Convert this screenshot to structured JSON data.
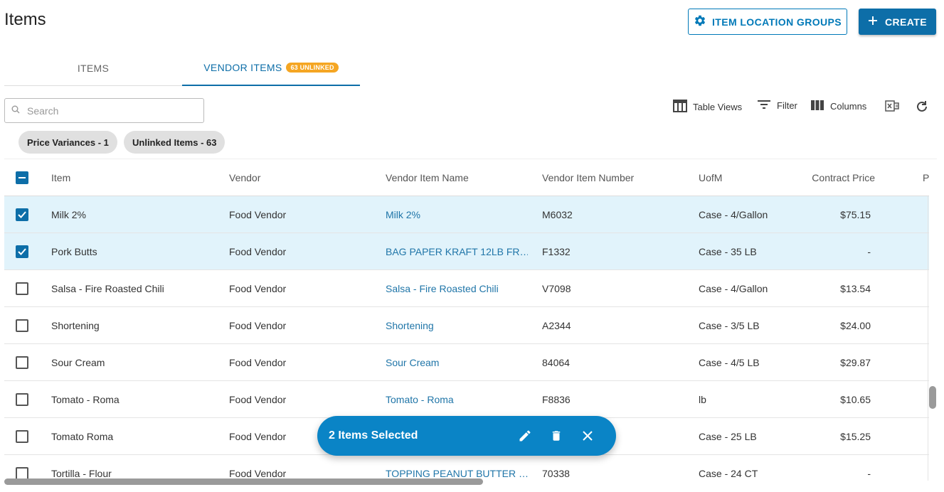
{
  "header": {
    "title": "Items",
    "location_groups_label": "ITEM LOCATION GROUPS",
    "create_label": "CREATE"
  },
  "tabs": [
    {
      "label": "ITEMS",
      "active": false
    },
    {
      "label": "VENDOR ITEMS",
      "active": true,
      "badge": "63 UNLINKED"
    }
  ],
  "search": {
    "placeholder": "Search",
    "value": ""
  },
  "toolbar": {
    "table_views": "Table Views",
    "filter": "Filter",
    "columns": "Columns"
  },
  "chips": [
    {
      "label": "Price Variances - 1"
    },
    {
      "label": "Unlinked Items - 63"
    }
  ],
  "table": {
    "columns": [
      "Item",
      "Vendor",
      "Vendor Item Name",
      "Vendor Item Number",
      "UofM",
      "Contract Price",
      "P"
    ],
    "rows": [
      {
        "selected": true,
        "item": "Milk 2%",
        "vendor": "Food Vendor",
        "vendor_item_name": "Milk 2%",
        "vendor_item_number": "M6032",
        "uofm": "Case - 4/Gallon",
        "contract_price": "$75.15"
      },
      {
        "selected": true,
        "item": "Pork Butts",
        "vendor": "Food Vendor",
        "vendor_item_name": "BAG PAPER KRAFT 12LB FR…",
        "vendor_item_number": "F1332",
        "uofm": "Case - 35 LB",
        "contract_price": "-"
      },
      {
        "selected": false,
        "item": "Salsa - Fire Roasted Chili",
        "vendor": "Food Vendor",
        "vendor_item_name": "Salsa - Fire Roasted Chili",
        "vendor_item_number": "V7098",
        "uofm": "Case - 4/Gallon",
        "contract_price": "$13.54"
      },
      {
        "selected": false,
        "item": "Shortening",
        "vendor": "Food Vendor",
        "vendor_item_name": "Shortening",
        "vendor_item_number": "A2344",
        "uofm": "Case - 3/5 LB",
        "contract_price": "$24.00"
      },
      {
        "selected": false,
        "item": "Sour Cream",
        "vendor": "Food Vendor",
        "vendor_item_name": "Sour Cream",
        "vendor_item_number": "84064",
        "uofm": "Case - 4/5 LB",
        "contract_price": "$29.87"
      },
      {
        "selected": false,
        "item": "Tomato - Roma",
        "vendor": "Food Vendor",
        "vendor_item_name": "Tomato - Roma",
        "vendor_item_number": "F8836",
        "uofm": "lb",
        "contract_price": "$10.65"
      },
      {
        "selected": false,
        "item": "Tomato Roma",
        "vendor": "Food Vendor",
        "vendor_item_name": "",
        "vendor_item_number": "",
        "uofm": "Case - 25 LB",
        "contract_price": "$15.25"
      },
      {
        "selected": false,
        "item": "Tortilla - Flour",
        "vendor": "Food Vendor",
        "vendor_item_name": "TOPPING PEANUT BUTTER …",
        "vendor_item_number": "70338",
        "uofm": "Case - 24 CT",
        "contract_price": "-"
      }
    ]
  },
  "selection_bar": {
    "label": "2 Items Selected"
  },
  "colors": {
    "primary": "#0d6ea8",
    "badge": "#f5a623",
    "selected_row": "#e1f3fb",
    "selection_bar": "#0a84c6"
  }
}
